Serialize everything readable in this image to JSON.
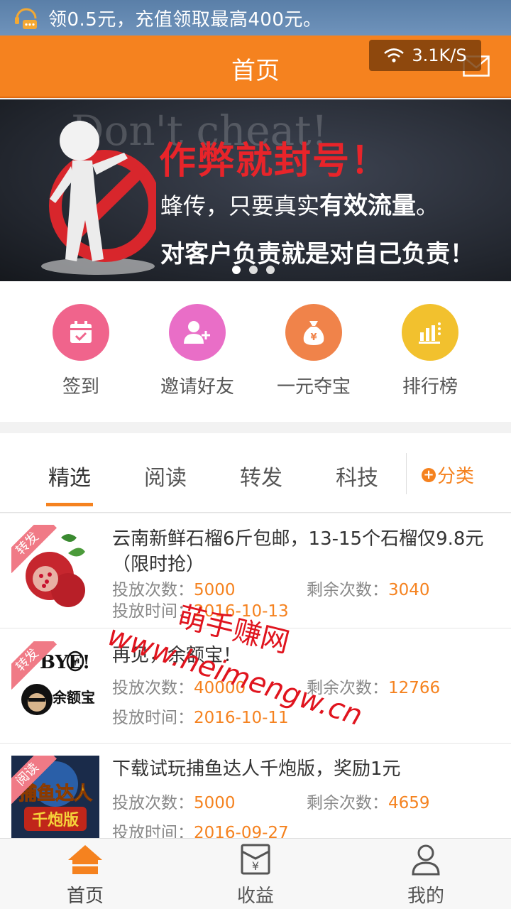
{
  "status_bar": {
    "notification_text": "领0.5元，充值领取最高400元。",
    "net_speed": "3.1K/S"
  },
  "header": {
    "title": "首页"
  },
  "banner": {
    "watermark": "Don't cheat!",
    "headline": "作弊就封号！",
    "sub_prefix": "蜂传，只要真实",
    "sub_bold": "有效流量",
    "sub_suffix": "。",
    "bottom": "对客户负责就是对自己负责！"
  },
  "quick_actions": [
    {
      "label": "签到",
      "icon": "calendar-check-icon",
      "color": "#f0648c"
    },
    {
      "label": "邀请好友",
      "icon": "add-user-icon",
      "color": "#e96ec7"
    },
    {
      "label": "一元夺宝",
      "icon": "money-bag-icon",
      "color": "#f0834a"
    },
    {
      "label": "排行榜",
      "icon": "bar-chart-icon",
      "color": "#f2c12e"
    }
  ],
  "tabs": [
    "精选",
    "阅读",
    "转发",
    "科技"
  ],
  "category_label": "分类",
  "list": [
    {
      "tag": "转发",
      "title": "云南新鲜石榴6斤包邮，13-15个石榴仅9.8元（限时抢）",
      "count_label": "投放次数：",
      "count": "5000",
      "remain_label": "剩余次数：",
      "remain": "3040",
      "time_label": "投放时间：",
      "time": "2016-10-13"
    },
    {
      "tag": "转发",
      "title": "再见，余额宝！",
      "count_label": "投放次数：",
      "count": "40000",
      "remain_label": "剩余次数：",
      "remain": "12766",
      "time_label": "投放时间：",
      "time": "2016-10-11"
    },
    {
      "tag": "阅读",
      "title": "下载试玩捕鱼达人千炮版，奖励1元",
      "count_label": "投放次数：",
      "count": "5000",
      "remain_label": "剩余次数：",
      "remain": "4659",
      "time_label": "投放时间：",
      "time": "2016-09-27"
    }
  ],
  "thumb_text": {
    "bye": "BYE!",
    "yuebao": "余额宝",
    "fish": "捕鱼达人",
    "fish2": "千炮版"
  },
  "overlay": {
    "line1": "萌手赚网",
    "line2": "www.heimengw.cn"
  },
  "bottom_nav": [
    {
      "label": "首页"
    },
    {
      "label": "收益"
    },
    {
      "label": "我的"
    }
  ],
  "colors": {
    "accent": "#f5821f",
    "value": "#f5821f",
    "status_bar": "#6f93bb"
  }
}
